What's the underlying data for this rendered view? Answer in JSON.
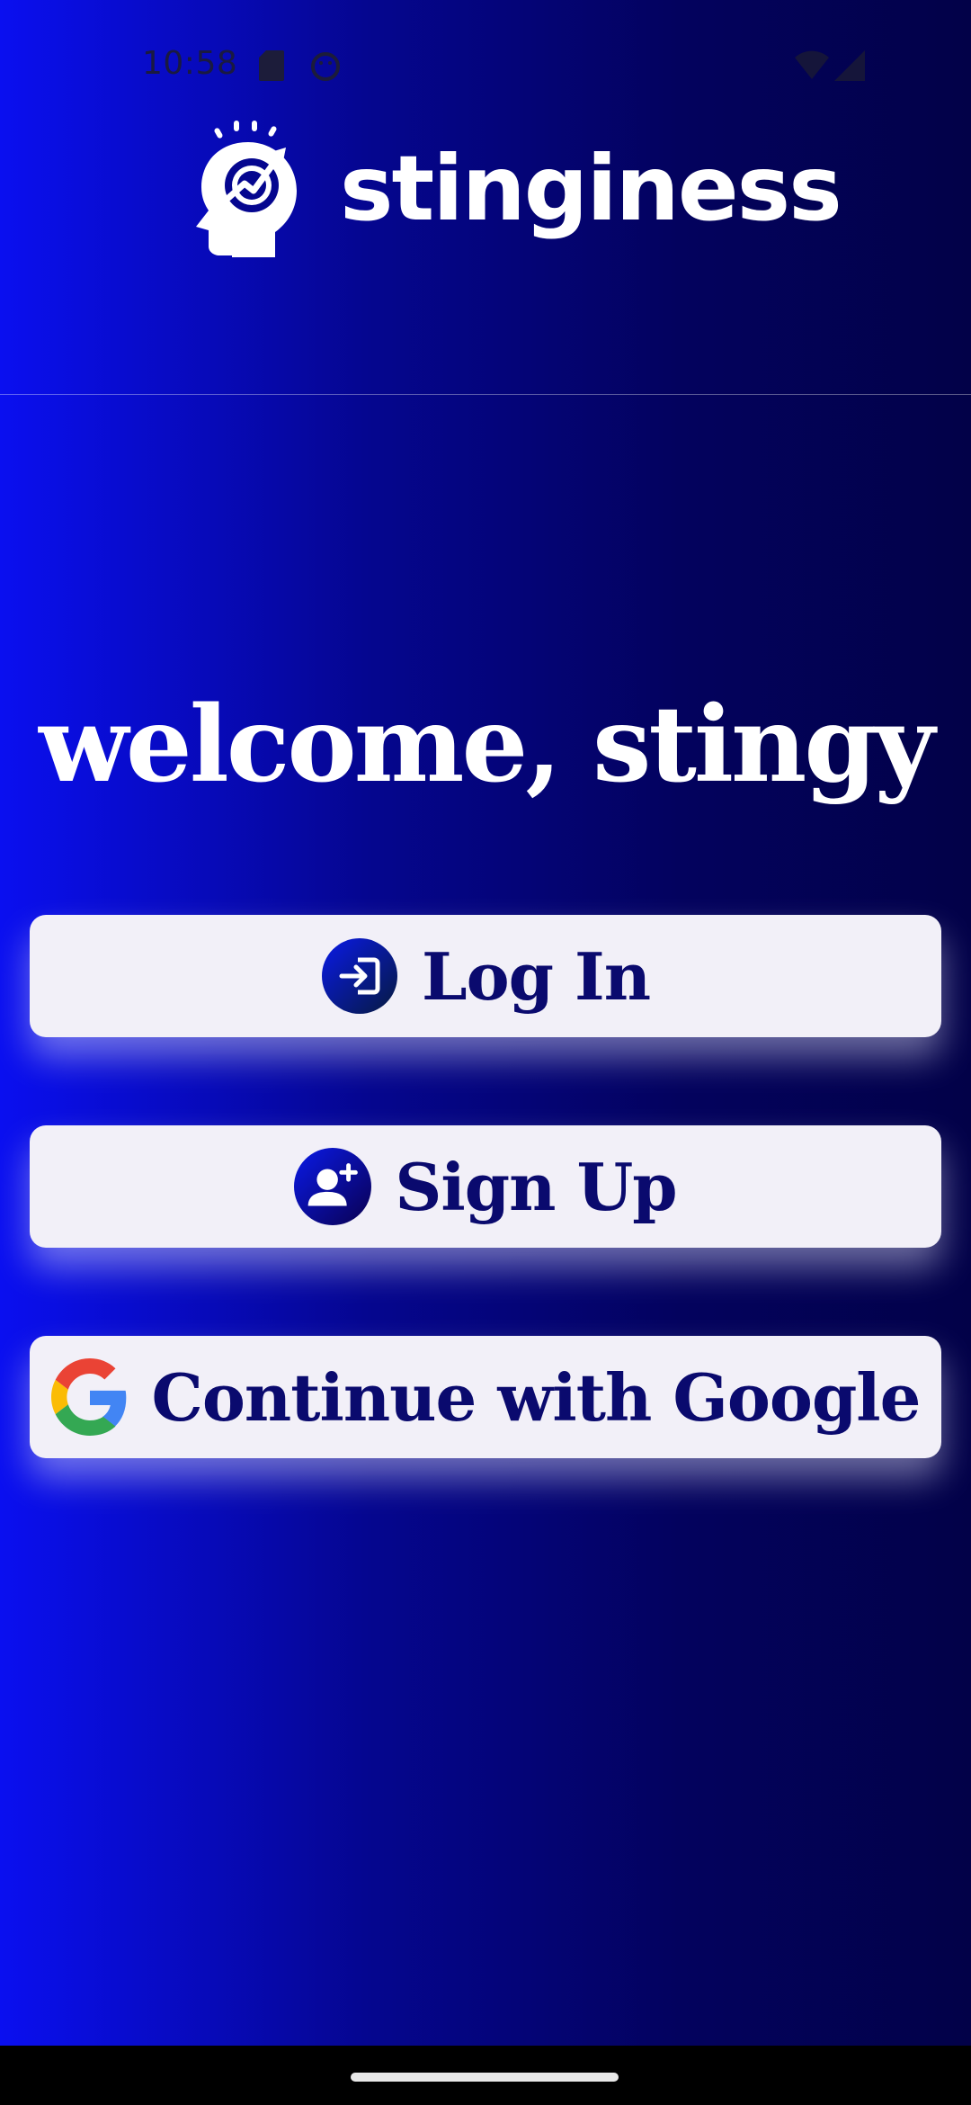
{
  "status_bar": {
    "time": "10:58",
    "icons": [
      "sd-card-icon",
      "android-icon",
      "wifi-icon",
      "signal-icon"
    ]
  },
  "header": {
    "app_name": "stinginess",
    "logo_icon": "head-growth-chart-icon"
  },
  "main": {
    "welcome_text": "welcome, stingy",
    "buttons": [
      {
        "label": "Log In",
        "icon": "login-icon"
      },
      {
        "label": "Sign Up",
        "icon": "add-user-icon"
      },
      {
        "label": "Continue with Google",
        "icon": "google-icon"
      }
    ]
  },
  "colors": {
    "background_left": "#0a0ff0",
    "background_right": "#020148",
    "button_bg": "#f2f0f8",
    "button_text": "#0a0a6e"
  }
}
